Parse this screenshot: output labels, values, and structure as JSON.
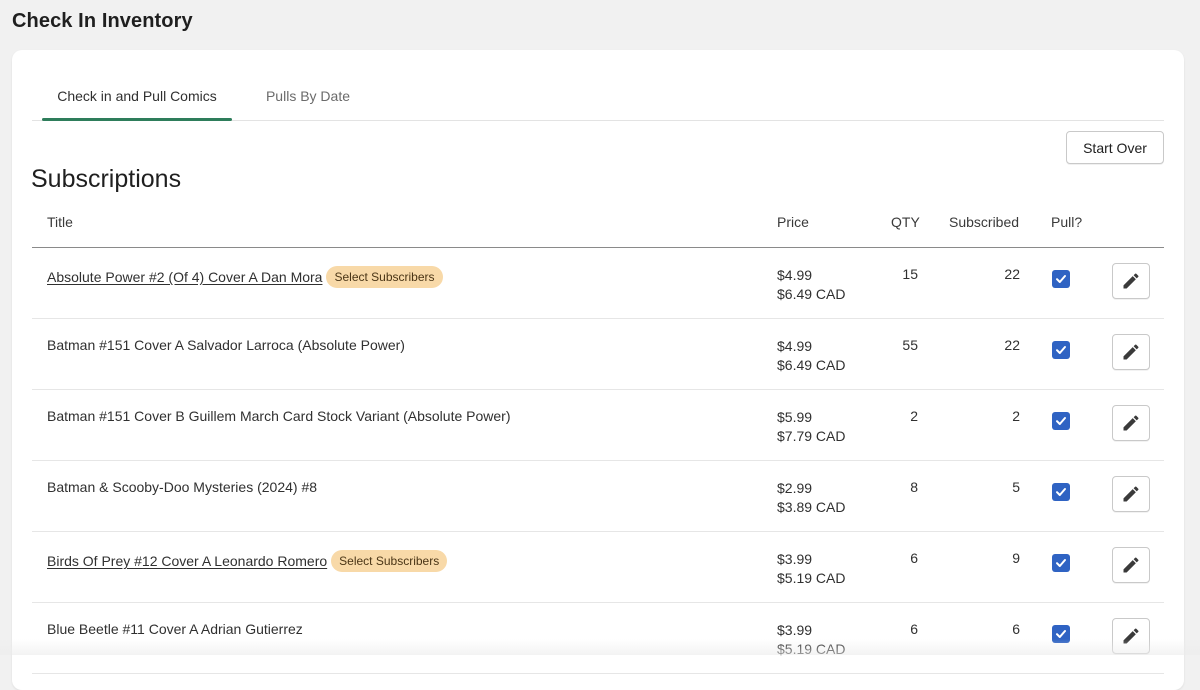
{
  "page": {
    "title": "Check In Inventory"
  },
  "tabs": [
    {
      "label": "Check in and Pull Comics",
      "active": true
    },
    {
      "label": "Pulls By Date",
      "active": false
    }
  ],
  "actions": {
    "start_over": "Start Over"
  },
  "section": {
    "title": "Subscriptions"
  },
  "table": {
    "headers": {
      "title": "Title",
      "price": "Price",
      "qty": "QTY",
      "subscribed": "Subscribed",
      "pull": "Pull?"
    },
    "rows": [
      {
        "title": "Absolute Power #2 (Of 4) Cover A Dan Mora",
        "link": true,
        "badge": "Select Subscribers",
        "price": "$4.99",
        "price_cad": "$6.49 CAD",
        "qty": "15",
        "subscribed": "22",
        "pull": true
      },
      {
        "title": "Batman #151 Cover A Salvador Larroca (Absolute Power)",
        "link": false,
        "badge": "",
        "price": "$4.99",
        "price_cad": "$6.49 CAD",
        "qty": "55",
        "subscribed": "22",
        "pull": true
      },
      {
        "title": "Batman #151 Cover B Guillem March Card Stock Variant (Absolute Power)",
        "link": false,
        "badge": "",
        "price": "$5.99",
        "price_cad": "$7.79 CAD",
        "qty": "2",
        "subscribed": "2",
        "pull": true
      },
      {
        "title": "Batman & Scooby-Doo Mysteries (2024) #8",
        "link": false,
        "badge": "",
        "price": "$2.99",
        "price_cad": "$3.89 CAD",
        "qty": "8",
        "subscribed": "5",
        "pull": true
      },
      {
        "title": "Birds Of Prey #12 Cover A Leonardo Romero",
        "link": true,
        "badge": "Select Subscribers",
        "price": "$3.99",
        "price_cad": "$5.19 CAD",
        "qty": "6",
        "subscribed": "9",
        "pull": true
      },
      {
        "title": "Blue Beetle #11 Cover A Adrian Gutierrez",
        "link": false,
        "badge": "",
        "price": "$3.99",
        "price_cad": "$5.19 CAD",
        "qty": "6",
        "subscribed": "6",
        "pull": true
      }
    ]
  },
  "icons": {
    "edit": "pencil-icon",
    "checkbox": "checkmark-icon"
  },
  "colors": {
    "tab_indicator": "#2e7d5b",
    "checkbox": "#2f63c3",
    "badge_bg": "#f8d9a8"
  }
}
